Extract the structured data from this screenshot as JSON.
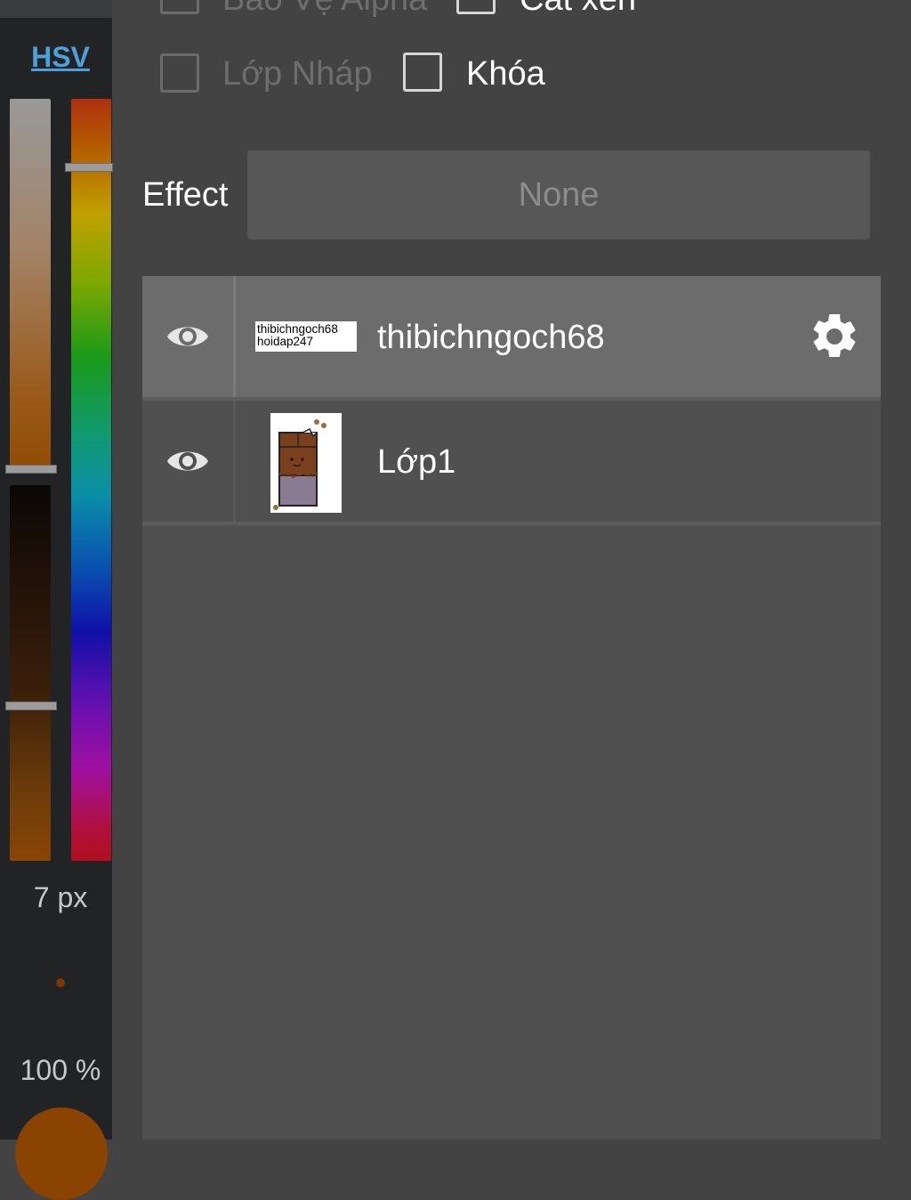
{
  "color_panel": {
    "mode_label": "HSV",
    "brush_size": "7 px",
    "opacity": "100 %",
    "current_color": "#8a4300"
  },
  "options": {
    "alpha_protect_label": "Bảo Vệ Alpha",
    "clipping_label": "Cắt xén",
    "draft_layer_label": "Lớp Nháp",
    "lock_label": "Khóa",
    "effect_label": "Effect",
    "effect_value": "None"
  },
  "layers": [
    {
      "name": "thibichngoch68",
      "thumbnail_line1": "thibichngoch68",
      "thumbnail_line2": "hoidap247",
      "visible": true,
      "selected": true
    },
    {
      "name": "Lớp1",
      "visible": true,
      "selected": false
    }
  ],
  "icons": {
    "visibility": "eye-icon",
    "settings": "gear-icon"
  },
  "colors": {
    "accent": "#4fa0d8",
    "panel_bg": "#222325",
    "list_bg": "#505050",
    "selected_row": "#6c6c6c"
  }
}
